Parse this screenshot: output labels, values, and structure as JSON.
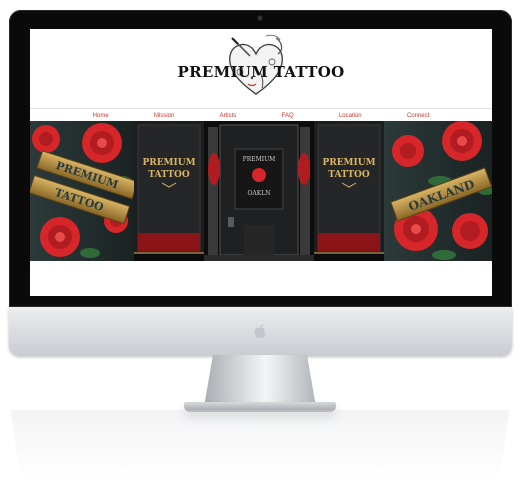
{
  "site": {
    "brand": "PREMIUM TATTOO",
    "nav": [
      {
        "label": "Home"
      },
      {
        "label": "Mission"
      },
      {
        "label": "Artists"
      },
      {
        "label": "FAQ"
      },
      {
        "label": "Location"
      },
      {
        "label": "Connect"
      }
    ],
    "hero": {
      "window_left": [
        "PREMIUM",
        "TATTOO"
      ],
      "window_right": [
        "PREMIUM",
        "TATTOO"
      ],
      "door_sign": [
        "PREMIUM",
        "OAKLN"
      ],
      "banner_left": [
        "PREMIUM",
        "TATTOO"
      ],
      "banner_right": "OAKLAND"
    }
  },
  "colors": {
    "nav_text": "#c0392b",
    "rose_red": "#d7262a",
    "leaf_green": "#2f6b3a",
    "banner_gold": "#b38a3a",
    "bezel": "#0a0a0a"
  },
  "icons": {
    "logo": "heart-tattoo-logo",
    "chin": "apple-logo-icon",
    "camera": "camera-icon"
  }
}
